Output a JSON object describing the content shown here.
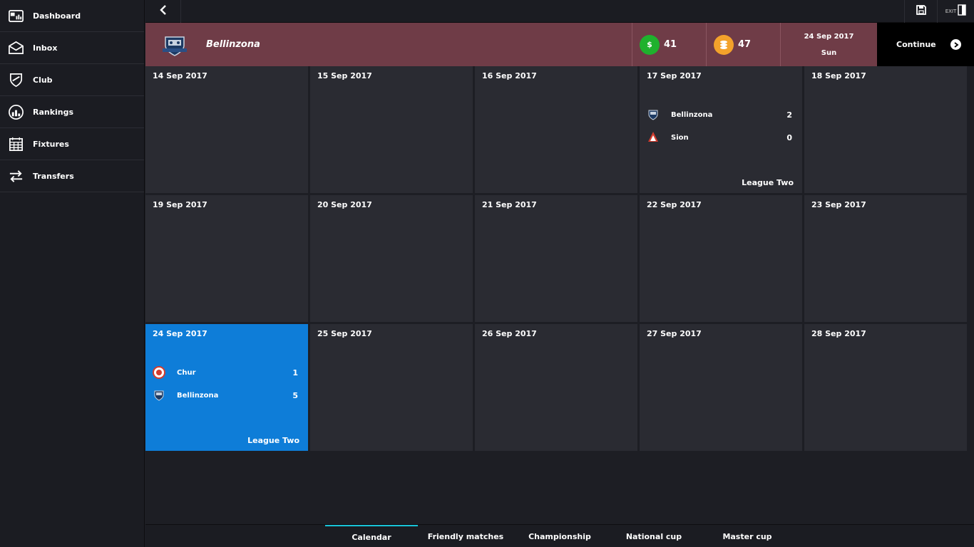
{
  "sidebar": {
    "items": [
      {
        "label": "Dashboard",
        "icon": "dashboard-icon"
      },
      {
        "label": "Inbox",
        "icon": "inbox-icon"
      },
      {
        "label": "Club",
        "icon": "club-shield-icon"
      },
      {
        "label": "Rankings",
        "icon": "rankings-icon"
      },
      {
        "label": "Fixtures",
        "icon": "calendar-icon"
      },
      {
        "label": "Transfers",
        "icon": "transfers-icon"
      }
    ]
  },
  "topbar": {
    "back_icon": "chevron-left-icon",
    "save_icon": "save-icon",
    "exit_label": "EXIT"
  },
  "header": {
    "club_name": "Bellinzona",
    "money": "41",
    "coins": "47",
    "date": "24 Sep 2017",
    "weekday": "Sun",
    "continue_label": "Continue",
    "money_symbol": "$",
    "colors": {
      "header_bg": "#6f3c47",
      "money": "#1fb12d",
      "coins": "#f3a22b"
    }
  },
  "calendar": {
    "days": [
      {
        "date": "14 Sep 2017"
      },
      {
        "date": "15 Sep 2017"
      },
      {
        "date": "16 Sep 2017"
      },
      {
        "date": "17 Sep 2017",
        "match": {
          "home": "Bellinzona",
          "home_score": "2",
          "away": "Sion",
          "away_score": "0",
          "competition": "League Two"
        }
      },
      {
        "date": "18 Sep 2017"
      },
      {
        "date": "19 Sep 2017"
      },
      {
        "date": "20 Sep 2017"
      },
      {
        "date": "21 Sep 2017"
      },
      {
        "date": "22 Sep 2017"
      },
      {
        "date": "23 Sep 2017"
      },
      {
        "date": "24 Sep 2017",
        "active": true,
        "match": {
          "home": "Chur",
          "home_score": "1",
          "away": "Bellinzona",
          "away_score": "5",
          "competition": "League Two"
        }
      },
      {
        "date": "25 Sep 2017"
      },
      {
        "date": "26 Sep 2017"
      },
      {
        "date": "27 Sep 2017"
      },
      {
        "date": "28 Sep 2017"
      }
    ],
    "active_color": "#0e7dd8"
  },
  "tabs": {
    "items": [
      {
        "label": "Calendar",
        "active": true
      },
      {
        "label": "Friendly matches"
      },
      {
        "label": "Championship"
      },
      {
        "label": "National cup"
      },
      {
        "label": "Master cup"
      }
    ],
    "accent": "#19c3d8"
  }
}
